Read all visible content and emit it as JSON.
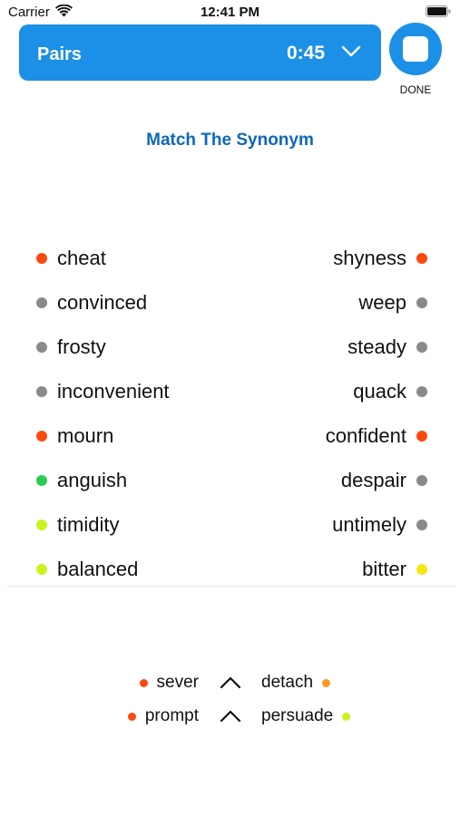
{
  "status_bar": {
    "carrier": "Carrier",
    "time": "12:41 PM",
    "wifi_icon": "wifi-icon",
    "battery_icon": "battery-icon"
  },
  "header": {
    "title": "Pairs",
    "timer": "0:45",
    "chevron_icon": "chevron-down-icon",
    "color": "#1c8fe6"
  },
  "done": {
    "label": "DONE",
    "icon": "stop-icon"
  },
  "page_title": "Match The Synonym",
  "colors": {
    "orange_red": "#fc4a0e",
    "gray": "#8a8a8a",
    "green": "#2bcb52",
    "lime": "#c9f41e",
    "yellow": "#f3e712",
    "orange": "#ff9a1f"
  },
  "left_words": [
    {
      "text": "cheat",
      "dot": "#fc4a0e"
    },
    {
      "text": "convinced",
      "dot": "#8a8a8a"
    },
    {
      "text": "frosty",
      "dot": "#8a8a8a"
    },
    {
      "text": "inconvenient",
      "dot": "#8a8a8a"
    },
    {
      "text": "mourn",
      "dot": "#fc4a0e"
    },
    {
      "text": "anguish",
      "dot": "#2bcb52"
    },
    {
      "text": "timidity",
      "dot": "#c9f41e"
    },
    {
      "text": "balanced",
      "dot": "#c9f41e"
    }
  ],
  "right_words": [
    {
      "text": "shyness",
      "dot": "#fc4a0e"
    },
    {
      "text": "weep",
      "dot": "#8a8a8a"
    },
    {
      "text": "steady",
      "dot": "#8a8a8a"
    },
    {
      "text": "quack",
      "dot": "#8a8a8a"
    },
    {
      "text": "confident",
      "dot": "#fc4a0e"
    },
    {
      "text": "despair",
      "dot": "#8a8a8a"
    },
    {
      "text": "untimely",
      "dot": "#8a8a8a"
    },
    {
      "text": "bitter",
      "dot": "#f3e712"
    }
  ],
  "matches": [
    {
      "left": "sever",
      "left_dot": "#fc4a0e",
      "right": "detach",
      "right_dot": "#ff9a1f",
      "icon": "caret-up-icon"
    },
    {
      "left": "prompt",
      "left_dot": "#fc4a0e",
      "right": "persuade",
      "right_dot": "#c9f41e",
      "icon": "caret-up-icon"
    }
  ]
}
